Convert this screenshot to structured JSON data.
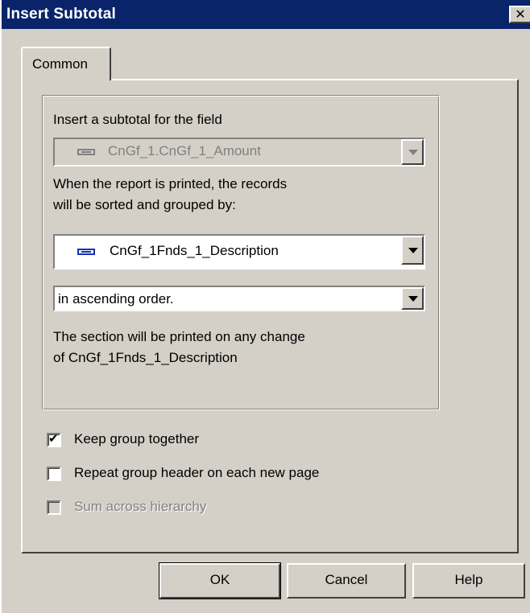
{
  "window": {
    "title": "Insert Subtotal",
    "close_glyph": "✕"
  },
  "tabs": [
    {
      "label": "Common",
      "selected": true
    }
  ],
  "subtotal": {
    "field_label": "Insert a subtotal for the field",
    "field_value": "CnGf_1.CnGf_1_Amount",
    "sorted_label_line1": "When the report is printed, the records",
    "sorted_label_line2": "will be sorted and grouped by:",
    "group_by_value": "CnGf_1Fnds_1_Description",
    "order_value": "in ascending order.",
    "section_note_line1": "The section will be printed on any change",
    "section_note_line2": "of  CnGf_1Fnds_1_Description"
  },
  "options": [
    {
      "label": "Keep group together",
      "checked": true,
      "enabled": true
    },
    {
      "label": "Repeat group header on each new page",
      "checked": false,
      "enabled": true
    },
    {
      "label": "Sum across hierarchy",
      "checked": false,
      "enabled": false
    }
  ],
  "buttons": {
    "ok": "OK",
    "cancel": "Cancel",
    "help": "Help"
  },
  "icons": {
    "field_icon": "database-field-icon",
    "dropdown_icon": "chevron-down-icon",
    "check_glyph": "✔"
  }
}
